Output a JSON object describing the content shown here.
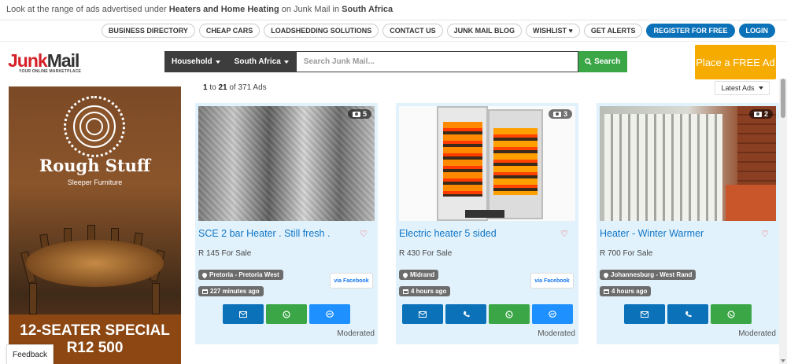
{
  "topbar": {
    "prefix": "Look at the range of ads advertised under ",
    "category": "Heaters and Home Heating",
    "middle": " on Junk Mail in ",
    "region": "South Africa"
  },
  "toplinks": [
    {
      "label": "BUSINESS DIRECTORY"
    },
    {
      "label": "CHEAP CARS"
    },
    {
      "label": "LOADSHEDDING SOLUTIONS"
    },
    {
      "label": "CONTACT US"
    },
    {
      "label": "JUNK MAIL BLOG"
    },
    {
      "label": "WISHLIST ♥"
    },
    {
      "label": "GET ALERTS"
    },
    {
      "label": "REGISTER FOR FREE"
    },
    {
      "label": "LOGIN"
    }
  ],
  "logo": {
    "part1": "Junk",
    "part2": "Mail",
    "tagline": "YOUR ONLINE MARKETPLACE"
  },
  "search": {
    "category": "Household",
    "region": "South Africa",
    "placeholder": "Search Junk Mail...",
    "button": "Search"
  },
  "place_ad": "Place a FREE Ad",
  "banner": {
    "brand": "Rough Stuff",
    "subtitle": "Sleeper Furniture",
    "line1": "12-SEATER SPECIAL",
    "line2": "R12 500"
  },
  "results": {
    "from": "1",
    "to_label": " to ",
    "to": "21",
    "of_label": " of ",
    "total": "371",
    "suffix": " Ads"
  },
  "sort": "Latest Ads",
  "listings": [
    {
      "title": "SCE 2 bar Heater . Still fresh .",
      "price": "R 145 For Sale",
      "location": "Pretoria - Pretoria West",
      "time": "227 minutes ago",
      "photos": "5",
      "facebook": "via Facebook",
      "status": "Moderated"
    },
    {
      "title": "Electric heater 5 sided",
      "price": "R 430 For Sale",
      "location": "Midrand",
      "time": "4 hours ago",
      "photos": "3",
      "facebook": "via Facebook",
      "status": "Moderated"
    },
    {
      "title": "Heater - Winter Warmer",
      "price": "R 700 For Sale",
      "location": "Johannesburg - West Rand",
      "time": "4 hours ago",
      "photos": "2",
      "status": "Moderated"
    }
  ],
  "feedback": "Feedback",
  "colors": {
    "brand_red": "#d42027",
    "link_blue": "#1176c6",
    "button_blue": "#0b72b9",
    "whatsapp_green": "#3aa645",
    "ad_orange": "#f6ab00",
    "card_bg": "#e2f2fc"
  }
}
